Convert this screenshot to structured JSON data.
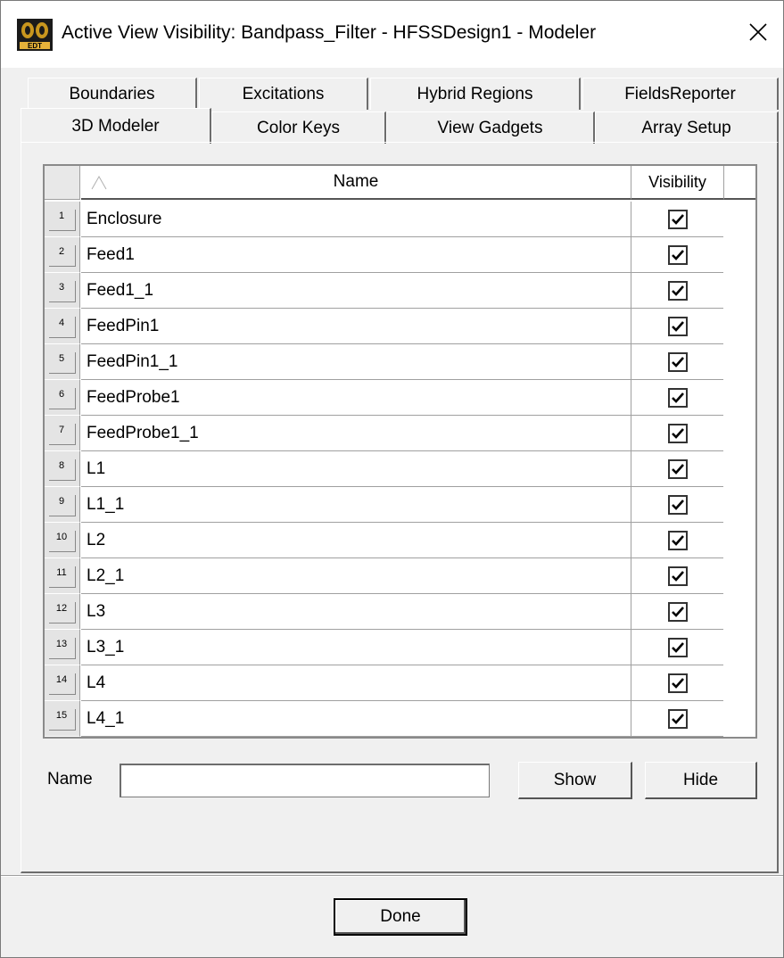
{
  "window": {
    "title": "Active View Visibility: Bandpass_Filter - HFSSDesign1 - Modeler",
    "app_icon": "edt-icon",
    "close_glyph": "✕"
  },
  "tabs": {
    "back_row": [
      {
        "label": "Boundaries"
      },
      {
        "label": "Excitations"
      },
      {
        "label": "Hybrid Regions"
      },
      {
        "label": "FieldsReporter"
      }
    ],
    "front_row": [
      {
        "label": "3D Modeler",
        "active": true
      },
      {
        "label": "Color Keys"
      },
      {
        "label": "View Gadgets"
      },
      {
        "label": "Array Setup"
      }
    ]
  },
  "grid": {
    "columns": {
      "name": "Name",
      "visibility": "Visibility"
    },
    "rows": [
      {
        "num": "1",
        "name": "Enclosure",
        "visible": true
      },
      {
        "num": "2",
        "name": "Feed1",
        "visible": true
      },
      {
        "num": "3",
        "name": "Feed1_1",
        "visible": true
      },
      {
        "num": "4",
        "name": "FeedPin1",
        "visible": true
      },
      {
        "num": "5",
        "name": "FeedPin1_1",
        "visible": true
      },
      {
        "num": "6",
        "name": "FeedProbe1",
        "visible": true
      },
      {
        "num": "7",
        "name": "FeedProbe1_1",
        "visible": true
      },
      {
        "num": "8",
        "name": "L1",
        "visible": true
      },
      {
        "num": "9",
        "name": "L1_1",
        "visible": true
      },
      {
        "num": "10",
        "name": "L2",
        "visible": true
      },
      {
        "num": "11",
        "name": "L2_1",
        "visible": true
      },
      {
        "num": "12",
        "name": "L3",
        "visible": true
      },
      {
        "num": "13",
        "name": "L3_1",
        "visible": true
      },
      {
        "num": "14",
        "name": "L4",
        "visible": true
      },
      {
        "num": "15",
        "name": "L4_1",
        "visible": true
      }
    ]
  },
  "filter": {
    "label": "Name",
    "value": "",
    "show_label": "Show",
    "hide_label": "Hide"
  },
  "footer": {
    "done_label": "Done"
  }
}
